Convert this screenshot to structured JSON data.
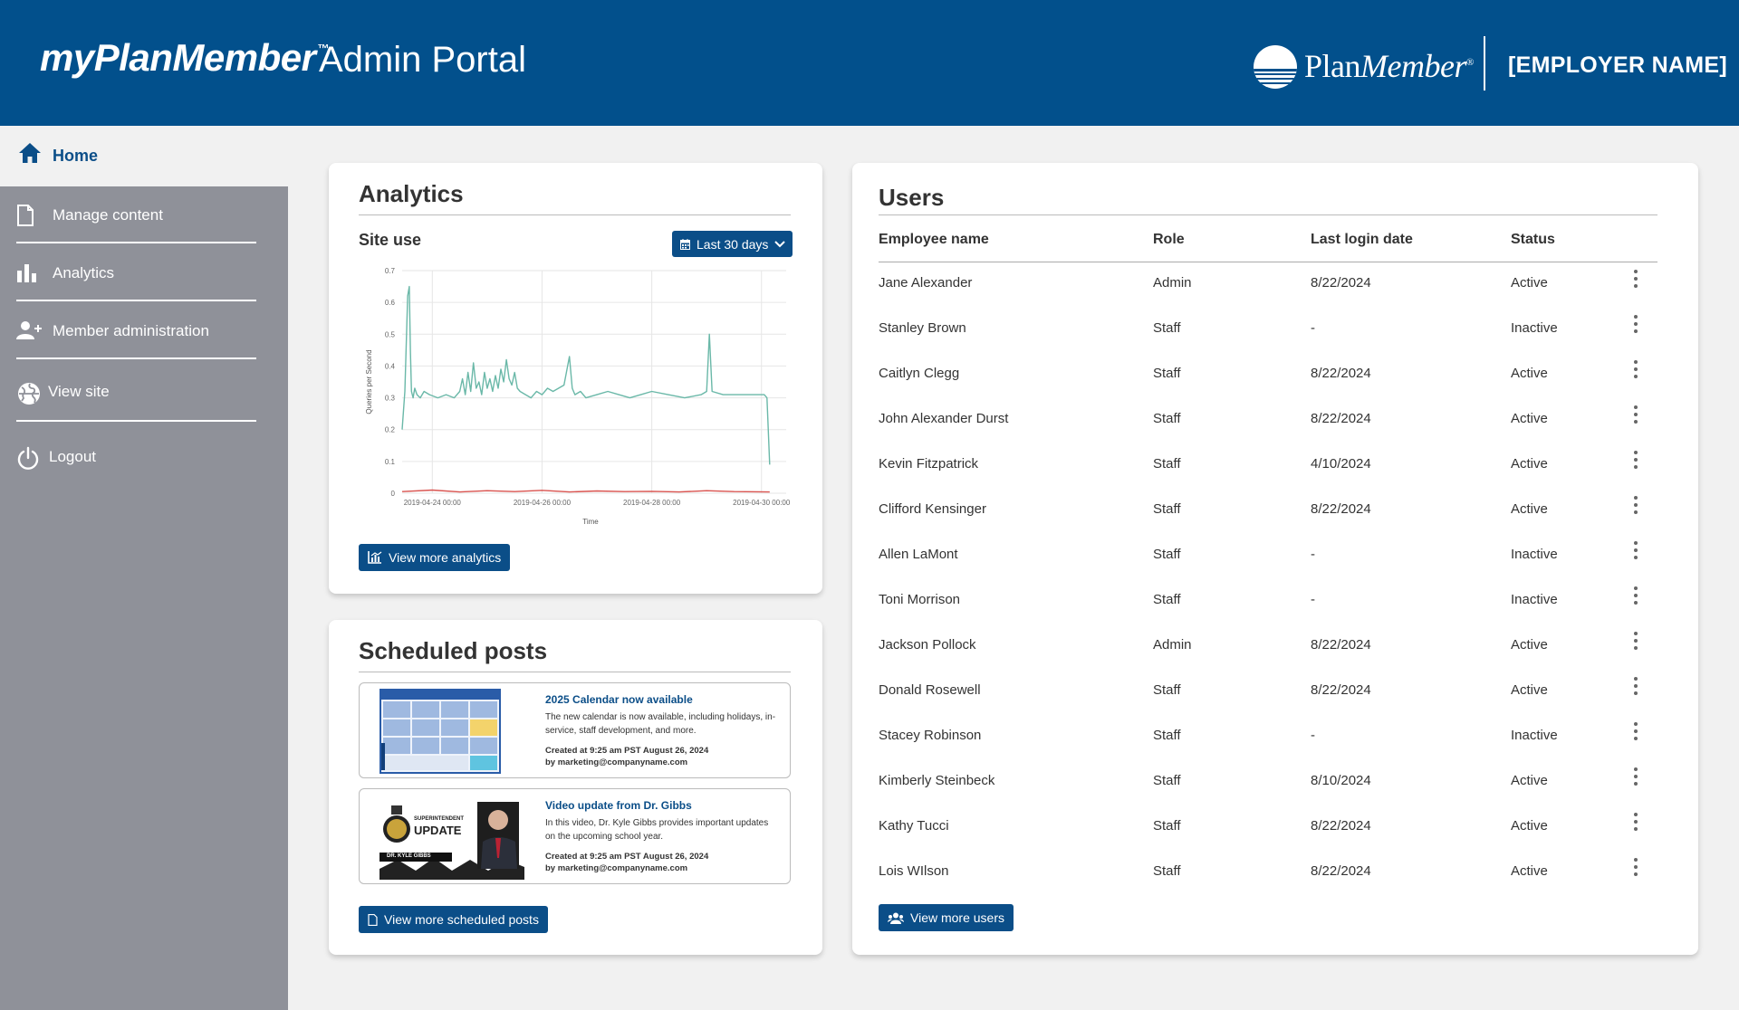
{
  "header": {
    "brand": "myPlanMember",
    "trademark": "™",
    "portal": "Admin Portal",
    "logo_plan": "Plan",
    "logo_member": "Member",
    "logo_reg": "®",
    "employer": "[EMPLOYER NAME]"
  },
  "sidebar": {
    "items": [
      {
        "label": "Home",
        "icon": "home-icon",
        "active": true
      },
      {
        "label": "Manage content",
        "icon": "document-icon"
      },
      {
        "label": "Analytics",
        "icon": "bar-chart-icon"
      },
      {
        "label": "Member administration",
        "icon": "add-user-icon"
      },
      {
        "label": "View site",
        "icon": "globe-icon"
      },
      {
        "label": "Logout",
        "icon": "power-icon"
      }
    ]
  },
  "analytics": {
    "title": "Analytics",
    "subtitle": "Site use",
    "range_button": "Last 30 days",
    "view_more": "View more analytics"
  },
  "chart_data": {
    "type": "line",
    "title": "",
    "xlabel": "Time",
    "ylabel": "Queries per Second",
    "ylim": [
      0,
      0.7
    ],
    "yticks": [
      "0",
      "0.1",
      "0.2",
      "0.3",
      "0.4",
      "0.5",
      "0.6",
      "0.7"
    ],
    "xticks": [
      "2019-04-24 00:00",
      "2019-04-26 00:00",
      "2019-04-28 00:00",
      "2019-04-30 00:00"
    ],
    "x_range_days": [
      -0.55,
      6.45
    ],
    "series": [
      {
        "color": "#6ab8a8",
        "x": [
          -0.55,
          -0.5,
          -0.45,
          -0.42,
          -0.4,
          -0.38,
          -0.35,
          -0.32,
          -0.28,
          -0.22,
          -0.15,
          -0.05,
          0.1,
          0.25,
          0.4,
          0.5,
          0.55,
          0.6,
          0.65,
          0.7,
          0.75,
          0.8,
          0.85,
          0.9,
          0.95,
          1.0,
          1.05,
          1.1,
          1.15,
          1.2,
          1.25,
          1.3,
          1.35,
          1.4,
          1.45,
          1.5,
          1.55,
          1.6,
          1.7,
          1.8,
          1.9,
          2.0,
          2.1,
          2.2,
          2.4,
          2.5,
          2.55,
          2.6,
          2.7,
          2.8,
          3.0,
          3.2,
          3.4,
          3.6,
          3.8,
          4.0,
          4.3,
          4.6,
          4.9,
          5.0,
          5.05,
          5.1,
          5.3,
          5.6,
          5.9,
          6.05,
          6.1,
          6.15
        ],
        "y": [
          0.2,
          0.32,
          0.62,
          0.65,
          0.45,
          0.32,
          0.3,
          0.33,
          0.31,
          0.3,
          0.32,
          0.31,
          0.3,
          0.31,
          0.3,
          0.32,
          0.36,
          0.31,
          0.38,
          0.32,
          0.41,
          0.33,
          0.35,
          0.31,
          0.38,
          0.33,
          0.36,
          0.32,
          0.37,
          0.33,
          0.39,
          0.35,
          0.42,
          0.36,
          0.34,
          0.38,
          0.33,
          0.32,
          0.31,
          0.3,
          0.32,
          0.31,
          0.33,
          0.32,
          0.34,
          0.43,
          0.33,
          0.31,
          0.32,
          0.3,
          0.31,
          0.32,
          0.31,
          0.3,
          0.31,
          0.32,
          0.31,
          0.3,
          0.31,
          0.32,
          0.5,
          0.32,
          0.31,
          0.31,
          0.31,
          0.31,
          0.3,
          0.09
        ]
      },
      {
        "color": "#d9534f",
        "x": [
          -0.55,
          0.0,
          0.5,
          1.0,
          1.5,
          2.0,
          2.5,
          3.0,
          3.5,
          4.0,
          4.5,
          5.0,
          5.5,
          6.15
        ],
        "y": [
          0.005,
          0.01,
          0.004,
          0.008,
          0.005,
          0.009,
          0.004,
          0.007,
          0.005,
          0.006,
          0.004,
          0.008,
          0.005,
          0.004
        ]
      }
    ],
    "grid": true,
    "legend": "none"
  },
  "posts": {
    "title": "Scheduled posts",
    "items": [
      {
        "title": "2025 Calendar now available",
        "desc": "The new calendar is now available, including holidays, in-service, staff development, and more.",
        "created": "Created at 9:25 am PST August 26, 2024",
        "by": "by marketing@companyname.com"
      },
      {
        "title": "Video update from Dr. Gibbs",
        "desc": "In this video, Dr. Kyle Gibbs provides important updates on the upcoming school year.",
        "created": "Created at 9:25 am PST August 26, 2024",
        "by": "by marketing@companyname.com",
        "thumb_text": {
          "top": "SUPERINTENDENT",
          "main": "UPDATE",
          "name": "DR. KYLE GIBBS"
        }
      }
    ],
    "view_more": "View more scheduled posts"
  },
  "users": {
    "title": "Users",
    "columns": [
      "Employee name",
      "Role",
      "Last login date",
      "Status"
    ],
    "rows": [
      [
        "Jane Alexander",
        "Admin",
        "8/22/2024",
        "Active"
      ],
      [
        "Stanley Brown",
        "Staff",
        "-",
        "Inactive"
      ],
      [
        "Caitlyn Clegg",
        "Staff",
        "8/22/2024",
        "Active"
      ],
      [
        "John Alexander Durst",
        "Staff",
        "8/22/2024",
        "Active"
      ],
      [
        "Kevin Fitzpatrick",
        "Staff",
        "4/10/2024",
        "Active"
      ],
      [
        "Clifford Kensinger",
        "Staff",
        "8/22/2024",
        "Active"
      ],
      [
        "Allen LaMont",
        "Staff",
        "-",
        "Inactive"
      ],
      [
        "Toni Morrison",
        "Staff",
        "-",
        "Inactive"
      ],
      [
        "Jackson Pollock",
        "Admin",
        "8/22/2024",
        "Active"
      ],
      [
        "Donald Rosewell",
        "Staff",
        "8/22/2024",
        "Active"
      ],
      [
        "Stacey Robinson",
        "Staff",
        "-",
        "Inactive"
      ],
      [
        "Kimberly Steinbeck",
        "Staff",
        "8/10/2024",
        "Active"
      ],
      [
        "Kathy Tucci",
        "Staff",
        "8/22/2024",
        "Active"
      ],
      [
        "Lois WIlson",
        "Staff",
        "8/22/2024",
        "Active"
      ]
    ],
    "view_more": "View more users"
  },
  "colors": {
    "header": "#02508c",
    "accent": "#0b4e88",
    "sidebar": "#8f9199",
    "background": "#f1f1f1"
  }
}
